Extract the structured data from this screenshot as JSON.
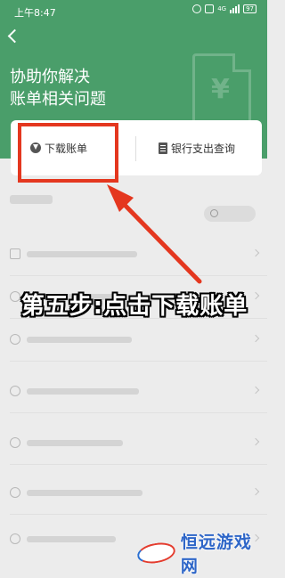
{
  "status_bar": {
    "time": "上午8:47",
    "network": "4G",
    "battery": "97"
  },
  "header": {
    "title_line1": "协助你解决",
    "title_line2": "账单相关问题",
    "illustration_symbol": "¥"
  },
  "actions": {
    "download_label": "下载账单",
    "bank_label": "银行支出查询"
  },
  "faq_items_count_note": null,
  "overlay": {
    "caption": "第五步:点击下载账单"
  },
  "watermark": {
    "text": "恒远游戏网"
  },
  "colors": {
    "header_green": "#4a9e6a",
    "highlight_red": "#e4371f",
    "watermark_blue": "#2e66c8"
  }
}
